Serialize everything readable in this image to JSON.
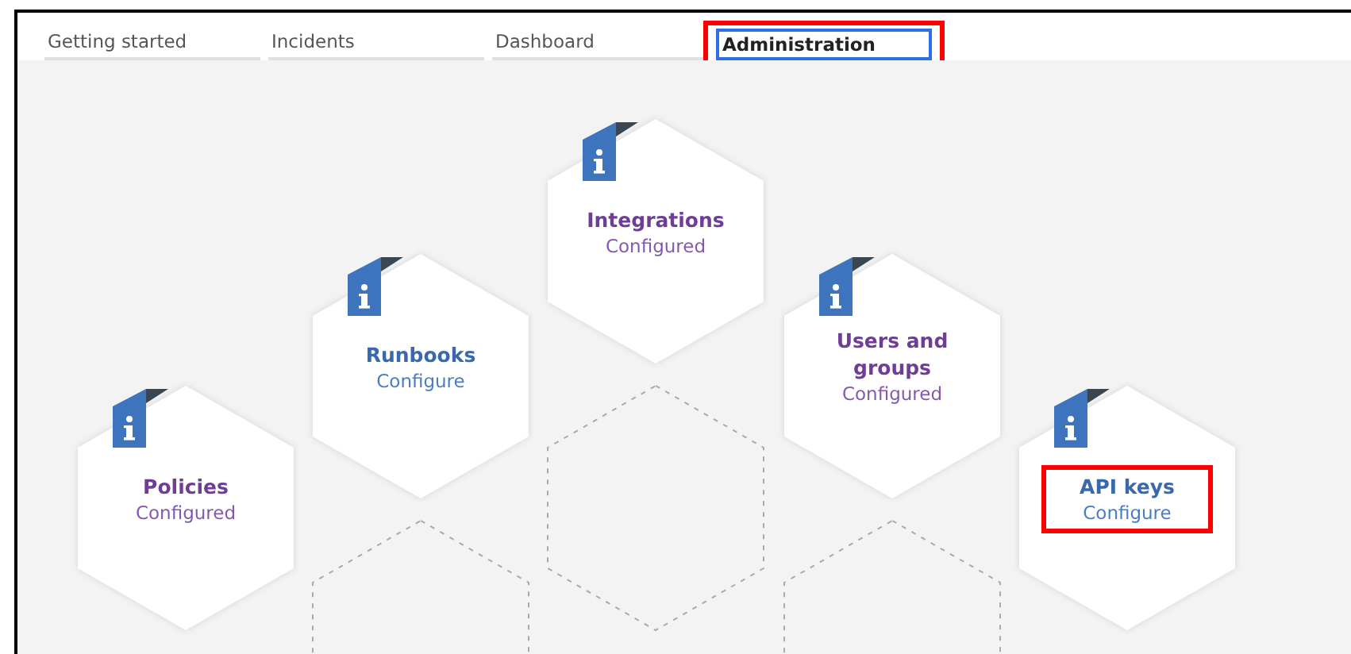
{
  "tabs": [
    {
      "label": "Getting started",
      "selected": false,
      "highlighted": false
    },
    {
      "label": "Incidents",
      "selected": false,
      "highlighted": false
    },
    {
      "label": "Dashboard",
      "selected": false,
      "highlighted": false
    },
    {
      "label": "Administration",
      "selected": true,
      "highlighted": true
    }
  ],
  "tiles": [
    {
      "title": "Policies",
      "status": "Configured",
      "configured": true,
      "highlighted": false
    },
    {
      "title": "Runbooks",
      "status": "Configure",
      "configured": false,
      "highlighted": false
    },
    {
      "title": "Integrations",
      "status": "Configured",
      "configured": true,
      "highlighted": false
    },
    {
      "title": "Users and groups",
      "status": "Configured",
      "configured": true,
      "highlighted": false
    },
    {
      "title": "API keys",
      "status": "Configure",
      "configured": false,
      "highlighted": true
    }
  ]
}
